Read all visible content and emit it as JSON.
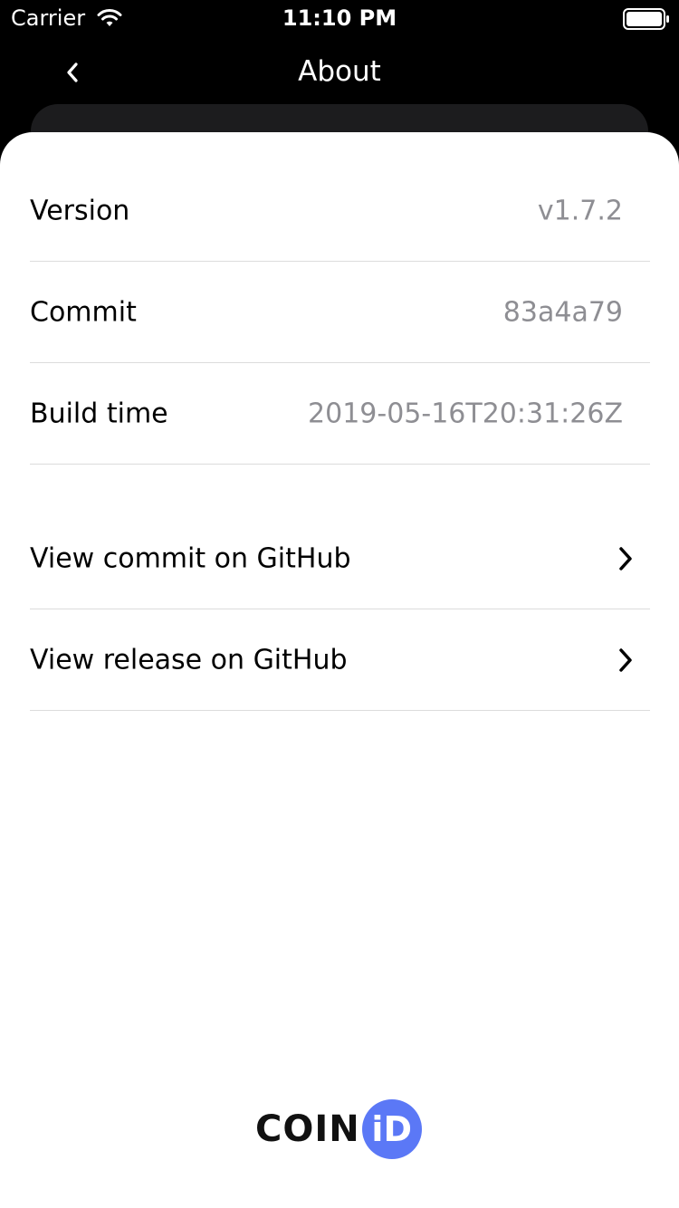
{
  "status_bar": {
    "carrier": "Carrier",
    "time": "11:10 PM"
  },
  "nav": {
    "title": "About",
    "back_icon": "chevron-left-icon"
  },
  "info_rows": [
    {
      "label": "Version",
      "value": "v1.7.2"
    },
    {
      "label": "Commit",
      "value": "83a4a79"
    },
    {
      "label": "Build time",
      "value": "2019-05-16T20:31:26Z"
    }
  ],
  "link_rows": [
    {
      "label": "View commit on GitHub",
      "icon": "chevron-right-icon"
    },
    {
      "label": "View release on GitHub",
      "icon": "chevron-right-icon"
    }
  ],
  "logo": {
    "text": "COIN",
    "badge": "iD",
    "badge_color": "#5b78f6"
  },
  "colors": {
    "background": "#000000",
    "sheet": "#ffffff",
    "secondary_text": "#8e8e93"
  }
}
